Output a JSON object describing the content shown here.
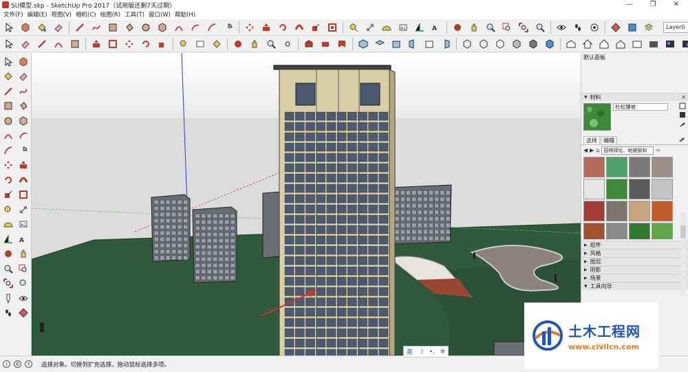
{
  "window": {
    "title": "SU模型.skp - SketchUp Pro 2017（试用版还剩7天过期）",
    "controls": [
      "—",
      "❐",
      "✕"
    ]
  },
  "menu": [
    "文件(F)",
    "编辑(E)",
    "视图(V)",
    "相机(C)",
    "绘图(R)",
    "工具(T)",
    "窗口(W)",
    "帮助(H)"
  ],
  "toolbar": {
    "layer_value": "Layer0"
  },
  "panel": {
    "title": "默认面板",
    "materials_label": "材料",
    "material_name": "杜松镶坡",
    "tabs": [
      "选择",
      "编辑"
    ],
    "library": "园林绿化、地被层和",
    "sections": [
      "组件",
      "风格",
      "图层",
      "阴影",
      "场景",
      "工具向导"
    ]
  },
  "status": {
    "text": "选择对象。切换到扩充选择。拖动鼠标选择多项。"
  },
  "ime": {
    "items": [
      "英",
      "☽",
      "•,",
      "✲"
    ]
  },
  "watermark": {
    "title": "土木工程网",
    "url": "www.civilcn.com"
  },
  "colors": {
    "sky": "#dcdcdc",
    "ground": "#2f5a3b",
    "tower": "#d9cfa6",
    "window": "#4b5a6e",
    "accent_red": "#c0392b"
  }
}
